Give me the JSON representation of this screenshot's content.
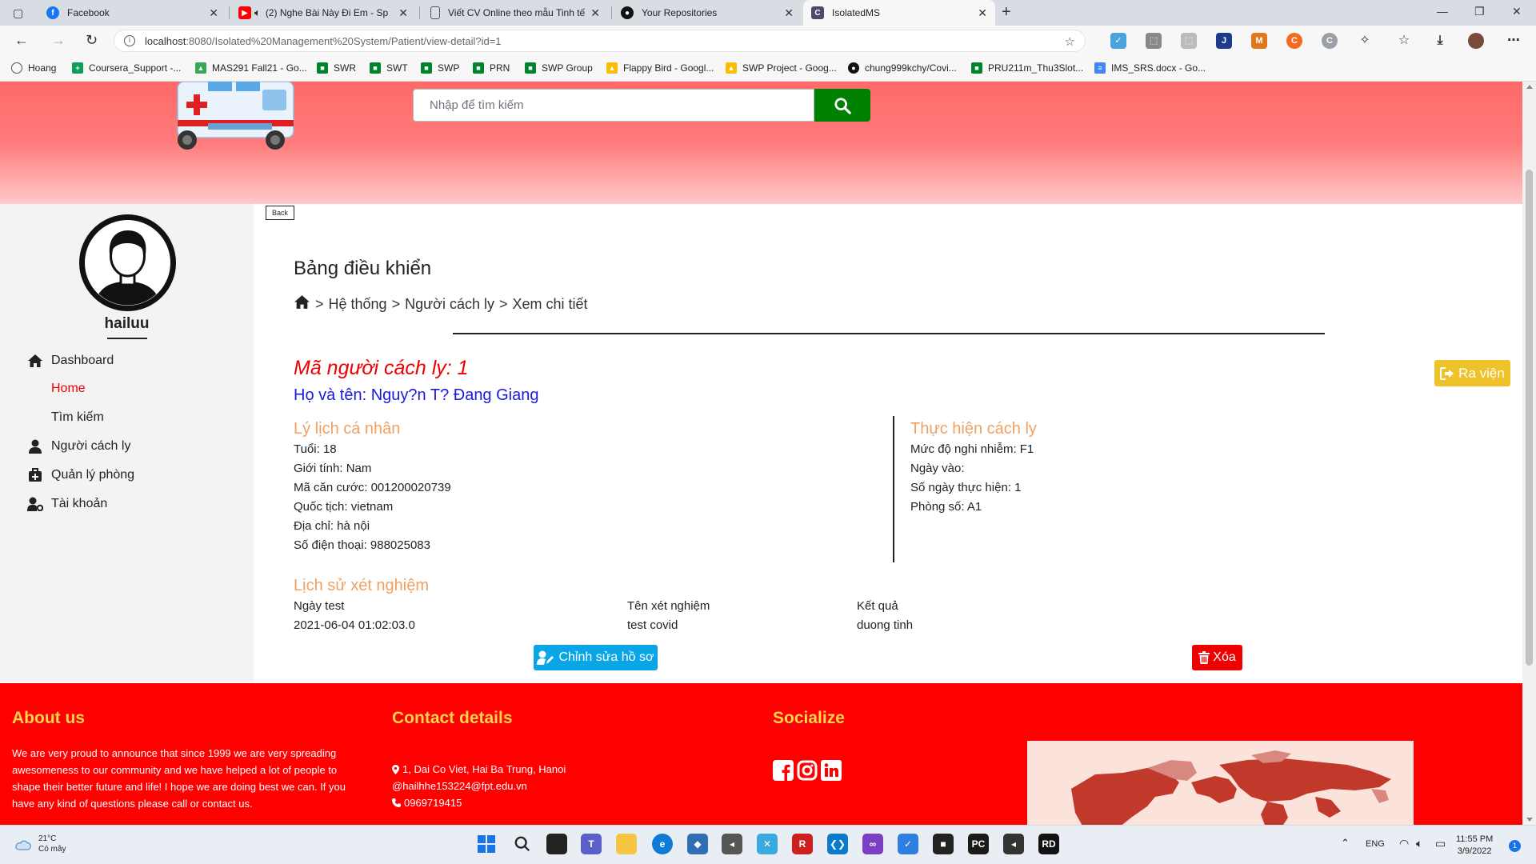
{
  "browser": {
    "tabs": [
      {
        "title": "Facebook",
        "icon": "facebook-icon",
        "color": "#1877f2"
      },
      {
        "title": "(2) Nghe Bài Này Đi Em - Sp",
        "icon": "youtube-icon",
        "color": "#ff0000"
      },
      {
        "title": "Viết CV Online theo mẫu Tinh tế",
        "icon": "page-icon",
        "color": "#666666"
      },
      {
        "title": "Your Repositories",
        "icon": "github-icon",
        "color": "#111111"
      },
      {
        "title": "IsolatedMS",
        "icon": "app-icon",
        "color": "#4a4a6a"
      }
    ],
    "url_host": "localhost",
    "url_rest": ":8080/Isolated%20Management%20System/Patient/view-detail?id=1",
    "bookmarks": [
      "Hoang",
      "Coursera_Support -...",
      "MAS291 Fall21 - Go...",
      "SWR",
      "SWT",
      "SWP",
      "PRN",
      "SWP Group",
      "Flappy Bird - Googl...",
      "SWP Project - Goog...",
      "chung999kchy/Covi...",
      "PRU211m_Thu3Slot...",
      "IMS_SRS.docx - Go..."
    ]
  },
  "header": {
    "search_placeholder": "Nhập để tìm kiếm"
  },
  "sidebar": {
    "username": "hailuu",
    "items": {
      "dashboard": "Dashboard",
      "home": "Home",
      "search": "Tìm kiếm",
      "patients": "Người cách ly",
      "rooms": "Quản lý phòng",
      "accounts": "Tài khoản"
    }
  },
  "main": {
    "back_label": "Back",
    "dashboard_title": "Bảng điều khiển",
    "breadcrumb": [
      "Hệ thống",
      "Người cách ly",
      "Xem chi tiết"
    ],
    "discharge_label": "Ra viện",
    "patient_id_line": "Mã người cách ly: 1",
    "patient_name_line": "Họ và tên: Nguy?n T? Đang Giang",
    "personal": {
      "title": "Lý lịch cá nhân",
      "lines": [
        "Tuổi: 18",
        "Giới tính: Nam",
        "Mã căn cước: 001200020739",
        "Quốc tịch: vietnam",
        "Địa chỉ: hà nội",
        "Số điện thoại: 988025083"
      ]
    },
    "isolation": {
      "title": "Thực hiện cách ly",
      "lines": [
        "Mức độ nghi nhiễm: F1",
        "Ngày vào:",
        "Số ngày thực hiện: 1",
        "Phòng số: A1"
      ]
    },
    "tests": {
      "title": "Lịch sử xét nghiệm",
      "headers": [
        "Ngày test",
        "Tên xét nghiệm",
        "Kết quả"
      ],
      "rows": [
        [
          "2021-06-04 01:02:03.0",
          "test covid",
          "duong tinh"
        ]
      ]
    },
    "edit_label": "Chỉnh sửa hồ sơ",
    "delete_label": "Xóa"
  },
  "footer": {
    "about_title": "About us",
    "about_text": "We are very proud to announce that since 1999 we are very spreading awesomeness to our community and we have helped a lot of people to shape their better future and life! I hope we are doing best we can. If you have any kind of questions please call or contact us.",
    "contact_title": "Contact details",
    "address": "1, Dai Co Viet, Hai Ba Trung, Hanoi",
    "email": "@hailhhe153224@fpt.edu.vn",
    "phone": "0969719415",
    "social_title": "Socialize"
  },
  "taskbar": {
    "temperature": "21°C",
    "weather": "Có mây",
    "lang": "ENG",
    "time": "11:55 PM",
    "date": "3/9/2022",
    "notifications": "1"
  },
  "colors": {
    "header_red": "#ff6969",
    "footer_red": "#ff0000",
    "accent_orange": "#f0a060",
    "link_blue": "#1a1adf",
    "search_green": "#008000",
    "discharge_yellow": "#f0c22a",
    "edit_blue": "#0aa5e6",
    "delete_red": "#ee0000"
  }
}
